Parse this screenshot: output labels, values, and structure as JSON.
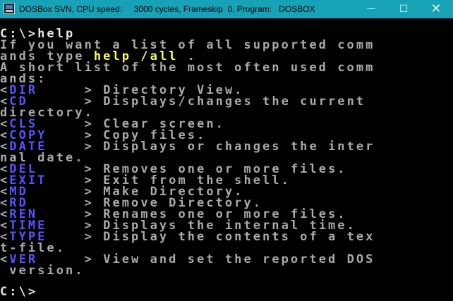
{
  "window": {
    "title": "DOSBox SVN, CPU speed:     3000 cycles, Frameskip  0, Program:   DOSBOX",
    "controls": {
      "minimize": "—",
      "maximize": "☐",
      "close": "✕"
    }
  },
  "console": {
    "prompt_line": "C:\\>help",
    "intro": {
      "l1": "If you want a list of all supported comm",
      "l2_pre": "ands type ",
      "l2_cmd": "help /all",
      "l2_post": " .",
      "l3": "A short list of the most often used comm",
      "l4": "ands:"
    },
    "commands": [
      {
        "name": "DIR",
        "desc": "Directory View."
      },
      {
        "name": "CD",
        "desc": "Displays/changes the current",
        "cont": "directory."
      },
      {
        "name": "CLS",
        "desc": "Clear screen."
      },
      {
        "name": "COPY",
        "desc": "Copy files."
      },
      {
        "name": "DATE",
        "desc": "Displays or changes the inter",
        "cont": "nal date."
      },
      {
        "name": "DEL",
        "desc": "Removes one or more files."
      },
      {
        "name": "EXIT",
        "desc": "Exit from the shell."
      },
      {
        "name": "MD",
        "desc": "Make Directory."
      },
      {
        "name": "RD",
        "desc": "Remove Directory."
      },
      {
        "name": "REN",
        "desc": "Renames one or more files."
      },
      {
        "name": "TIME",
        "desc": "Displays the internal time."
      },
      {
        "name": "TYPE",
        "desc": "Display the contents of a tex",
        "cont": "t-file."
      },
      {
        "name": "VER",
        "desc": "View and set the reported DOS",
        "cont": " version."
      }
    ],
    "bracket_open": "<",
    "bracket_close": ">",
    "final_prompt": "C:\\>"
  },
  "colors": {
    "titlebar": "#17a2b8",
    "console_bg": "#000000",
    "text": "#aaaaaa",
    "highlight": "#ffff55",
    "command": "#5555ff"
  }
}
